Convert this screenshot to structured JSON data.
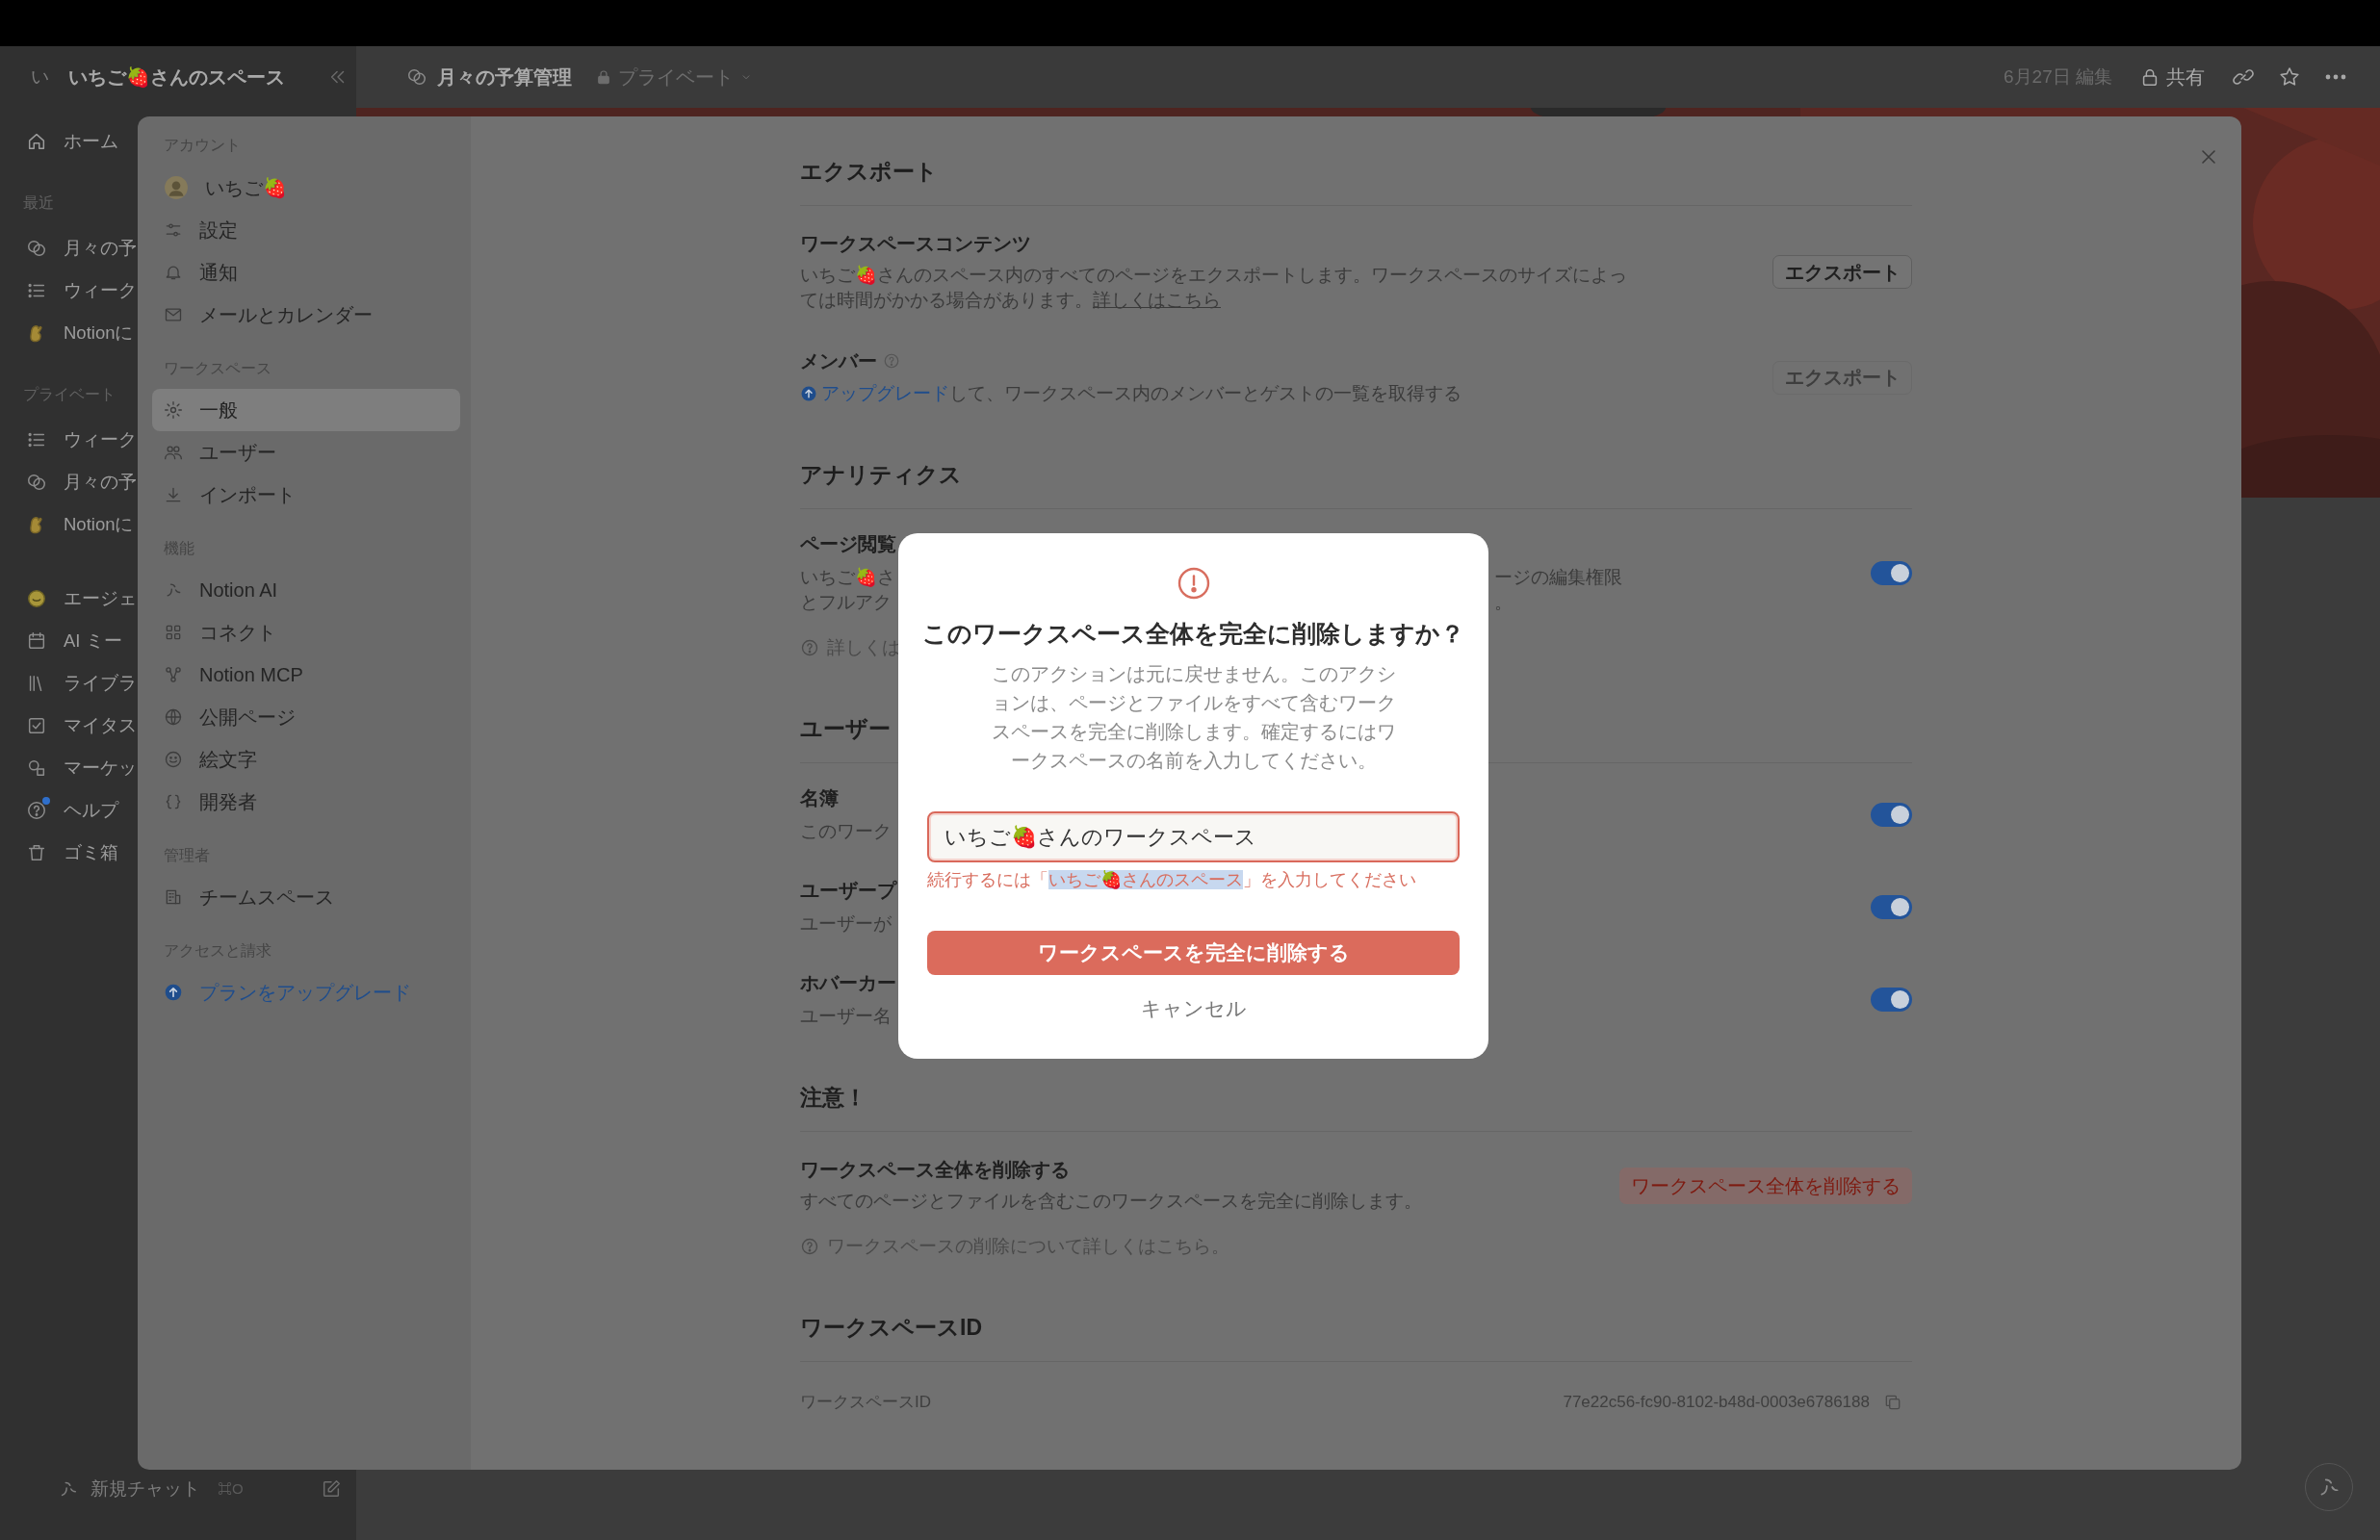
{
  "top_bar": {
    "workspace_initial": "い",
    "workspace_name": "いちご🍓さんのスペース",
    "page_title": "月々の予算管理",
    "privacy": "プライベート",
    "edited": "6月27日 編集",
    "share": "共有"
  },
  "sidebar": {
    "home": "ホーム",
    "sections": [
      {
        "label": "最近",
        "items": [
          {
            "label": "月々の予",
            "notification": false
          },
          {
            "label": "ウィーク",
            "notification": false
          },
          {
            "label": "Notionに",
            "notification": false
          }
        ]
      },
      {
        "label": "プライベート",
        "items": [
          {
            "label": "ウィーク",
            "notification": false
          },
          {
            "label": "月々の予",
            "notification": false
          },
          {
            "label": "Notionに",
            "notification": false
          }
        ]
      },
      {
        "items": [
          {
            "label": "エージェ",
            "notification": false
          },
          {
            "label": "AI ミー",
            "notification": false
          },
          {
            "label": "ライブラ",
            "notification": false
          },
          {
            "label": "マイタス",
            "notification": false
          },
          {
            "label": "マーケッ",
            "notification": false
          },
          {
            "label": "ヘルプ",
            "notification": true
          },
          {
            "label": "ゴミ箱",
            "notification": false
          }
        ]
      }
    ],
    "new_chat": "新規チャット",
    "new_chat_shortcut": "⌘O"
  },
  "settings": {
    "nav": [
      {
        "label": "アカウント",
        "items": [
          {
            "label": "いちご🍓",
            "kind": "item",
            "selected": false
          },
          {
            "label": "設定",
            "kind": "item",
            "selected": false
          },
          {
            "label": "通知",
            "kind": "item",
            "selected": false
          },
          {
            "label": "メールとカレンダー",
            "kind": "item",
            "selected": false
          }
        ]
      },
      {
        "label": "ワークスペース",
        "items": [
          {
            "label": "一般",
            "kind": "item",
            "selected": true
          },
          {
            "label": "ユーザー",
            "kind": "item",
            "selected": false
          },
          {
            "label": "インポート",
            "kind": "item",
            "selected": false
          }
        ]
      },
      {
        "label": "機能",
        "items": [
          {
            "label": "Notion AI",
            "kind": "item",
            "selected": false
          },
          {
            "label": "コネクト",
            "kind": "item",
            "selected": false
          },
          {
            "label": "Notion MCP",
            "kind": "item",
            "selected": false
          },
          {
            "label": "公開ページ",
            "kind": "item",
            "selected": false
          },
          {
            "label": "絵文字",
            "kind": "item",
            "selected": false
          },
          {
            "label": "開発者",
            "kind": "item",
            "selected": false
          }
        ]
      },
      {
        "label": "管理者",
        "items": [
          {
            "label": "チームスペース",
            "kind": "item",
            "selected": false
          }
        ]
      },
      {
        "label": "アクセスと請求",
        "items": [
          {
            "label": "プランをアップグレード",
            "kind": "upgrade",
            "selected": false
          }
        ]
      }
    ],
    "sections": [
      {
        "title": "エクスポート",
        "rows": [
          {
            "kind": "button",
            "title": "ワークスペースコンテンツ",
            "description": "いちご🍓さんのスペース内のすべてのページをエクスポートします。ワークスペースのサイズによっては時間がかかる場合があります。",
            "link": "詳しくはこちら",
            "button": "エクスポート",
            "disabled": false
          },
          {
            "kind": "button",
            "title": "メンバー",
            "help_icon": true,
            "upgrade_link": "アップグレード",
            "description": "して、ワークスペース内のメンバーとゲストの一覧を取得する",
            "button": "エクスポート",
            "disabled": true
          }
        ]
      },
      {
        "title": "アナリティクス",
        "rows": [
          {
            "kind": "toggle",
            "title": "ページ閲覧",
            "description_left": [
              "いちご🍓さ",
              "とフルアク"
            ],
            "description_right": [
              "ージの編集権限",
              "。"
            ],
            "help": "詳しくは",
            "on": true
          }
        ]
      },
      {
        "title": "ユーザー",
        "rows": [
          {
            "kind": "toggle",
            "title": "名簿",
            "description_left": [
              "このワーク"
            ],
            "on": true
          },
          {
            "kind": "toggle",
            "title": "ユーザープ",
            "description_left": [
              "ユーザーが"
            ],
            "on": true
          },
          {
            "kind": "toggle",
            "title": "ホバーカー",
            "description_left": [
              "ユーザー名"
            ],
            "on": true
          }
        ]
      },
      {
        "title": "注意！",
        "rows": [
          {
            "kind": "danger",
            "title": "ワークスペース全体を削除する",
            "description": "すべてのページとファイルを含むこのワークスペースを完全に削除します。",
            "button": "ワークスペース全体を削除する",
            "help": "ワークスペースの削除について詳しくはこちら。"
          }
        ]
      },
      {
        "title": "ワークスペースID",
        "rows": [
          {
            "kind": "id",
            "label": "ワークスペースID",
            "value": "77e22c56-fc90-8102-b48d-0003e6786188"
          }
        ]
      }
    ]
  },
  "dialog": {
    "title": "このワークスペース全体を完全に削除しますか？",
    "message": "このアクションは元に戻せません。このアクションは、ページとファイルをすべて含むワークスペースを完全に削除します。確定するにはワークスペースの名前を入力してください。",
    "input_value": "いちご🍓さんのワークスペース",
    "invalid": true,
    "error_prefix": "続行するには「",
    "error_highlight": "いちご🍓さんのスペース",
    "highlight_selected": true,
    "error_suffix": "」を入力してください",
    "confirm": "ワークスペースを完全に削除する",
    "cancel": "キャンセル"
  }
}
